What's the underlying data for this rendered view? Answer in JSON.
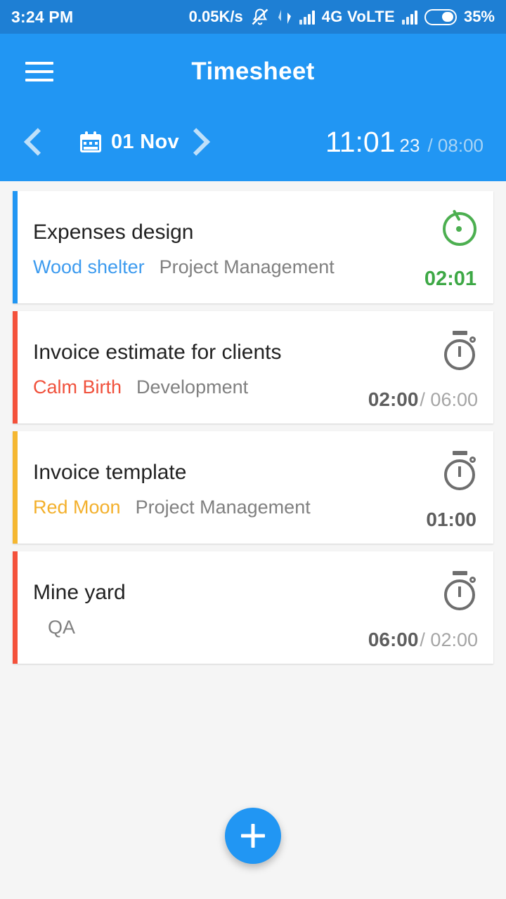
{
  "statusbar": {
    "time": "3:24 PM",
    "network_speed": "0.05K/s",
    "mute_icon": "bell-muted-icon",
    "data_transfer_icon": "data-transfer-icon",
    "signal_icon": "signal-bars-icon",
    "network_type": "4G VoLTE",
    "signal_icon_2": "signal-bars-icon",
    "battery_icon": "battery-icon",
    "battery_percent": "35%"
  },
  "appbar": {
    "menu_icon": "hamburger-menu-icon",
    "title": "Timesheet",
    "color": "#2196F3"
  },
  "datebar": {
    "prev_icon": "chevron-left-icon",
    "calendar_icon": "calendar-icon",
    "date": "01 Nov",
    "next_icon": "chevron-right-icon",
    "total_main": "11:01",
    "total_seconds": "23",
    "total_separator": "/",
    "total_target": "08:00"
  },
  "entries": [
    {
      "title": "Expenses design",
      "project": "Wood shelter",
      "category": "Project Management",
      "accent_color": "#2196F3",
      "project_color": "#3D9BEF",
      "timer_icon": "timer-running-icon",
      "running": true,
      "spent": "02:01",
      "estimate": ""
    },
    {
      "title": "Invoice estimate for clients",
      "project": "Calm Birth",
      "category": "Development",
      "accent_color": "#F4513B",
      "project_color": "#F0513C",
      "timer_icon": "stopwatch-icon",
      "running": false,
      "spent": "02:00",
      "estimate": "/ 06:00"
    },
    {
      "title": "Invoice template",
      "project": "Red Moon",
      "category": "Project Management",
      "accent_color": "#F5B731",
      "project_color": "#F3B02C",
      "timer_icon": "stopwatch-icon",
      "running": false,
      "spent": "01:00",
      "estimate": ""
    },
    {
      "title": "Mine yard",
      "project": "",
      "category": "QA",
      "accent_color": "#F4513B",
      "project_color": "#F0513C",
      "timer_icon": "stopwatch-icon",
      "running": false,
      "spent": "06:00",
      "estimate": "/ 02:00"
    }
  ],
  "fab": {
    "icon": "plus-icon",
    "color": "#2196F3"
  }
}
